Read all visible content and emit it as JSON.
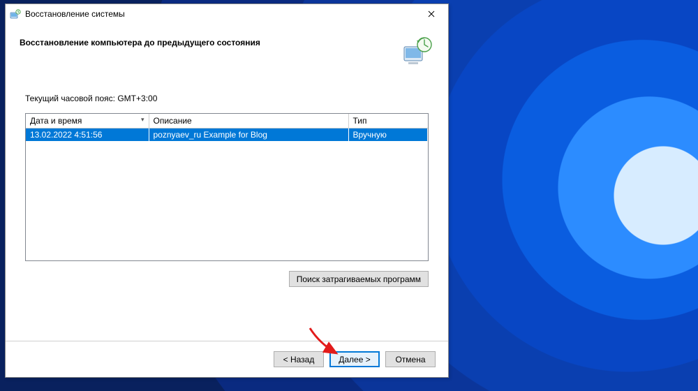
{
  "window": {
    "title": "Восстановление системы"
  },
  "header": {
    "heading": "Восстановление компьютера до предыдущего состояния"
  },
  "timezone_label": "Текущий часовой пояс: GMT+3:00",
  "table": {
    "columns": {
      "datetime": "Дата и время",
      "description": "Описание",
      "type": "Тип"
    },
    "rows": [
      {
        "datetime": "13.02.2022 4:51:56",
        "description": "poznyaev_ru Example for Blog",
        "type": "Вручную",
        "selected": true
      }
    ]
  },
  "buttons": {
    "affected": "Поиск затрагиваемых программ",
    "back": "< Назад",
    "next": "Далее >",
    "cancel": "Отмена"
  }
}
